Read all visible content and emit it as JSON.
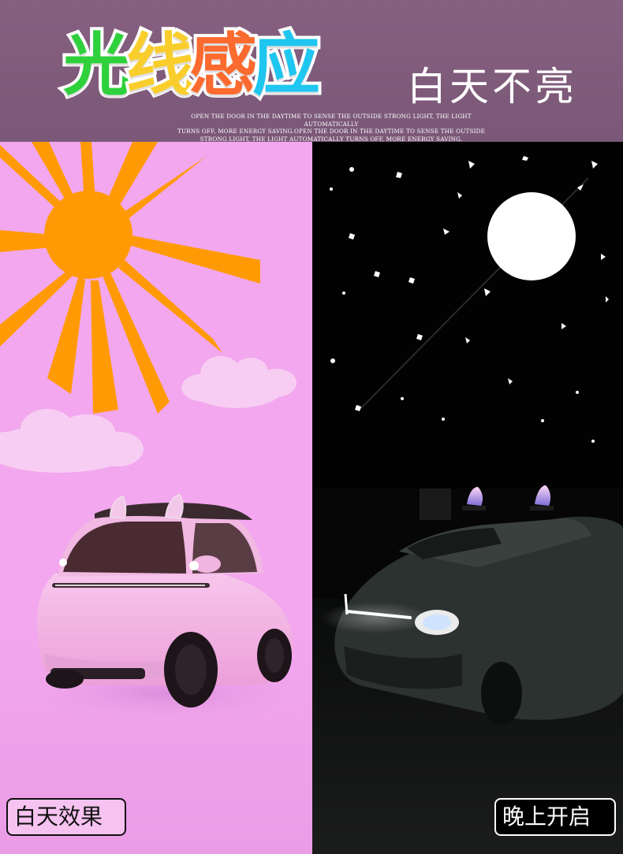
{
  "header": {
    "title_chars": [
      {
        "char": "光",
        "color": "#2ed13b"
      },
      {
        "char": "线",
        "color": "#f9ce2c"
      },
      {
        "char": "感",
        "color": "#fb6a2e"
      },
      {
        "char": "应",
        "color": "#1fc6f0"
      }
    ],
    "subtitle": "白天不亮",
    "english_line1": "OPEN THE DOOR IN THE DAYTIME TO SENSE THE OUTSIDE STRONG LIGHT, THE LIGHT AUTOMATICALLY",
    "english_line2": "TURNS OFF, MORE ENERGY SAVING.OPEN THE DOOR IN THE DAYTIME TO SENSE THE OUTSIDE",
    "english_line3": "STRONG LIGHT, THE LIGHT AUTOMATICALLY TURNS OFF, MORE ENERGY SAVING."
  },
  "day_panel": {
    "label": "白天效果",
    "bg_color": "#f2a7ee",
    "sun_color": "#ff9a05"
  },
  "night_panel": {
    "label": "晚上开启",
    "bg_color": "#020202",
    "moon_color": "#ffffff"
  }
}
